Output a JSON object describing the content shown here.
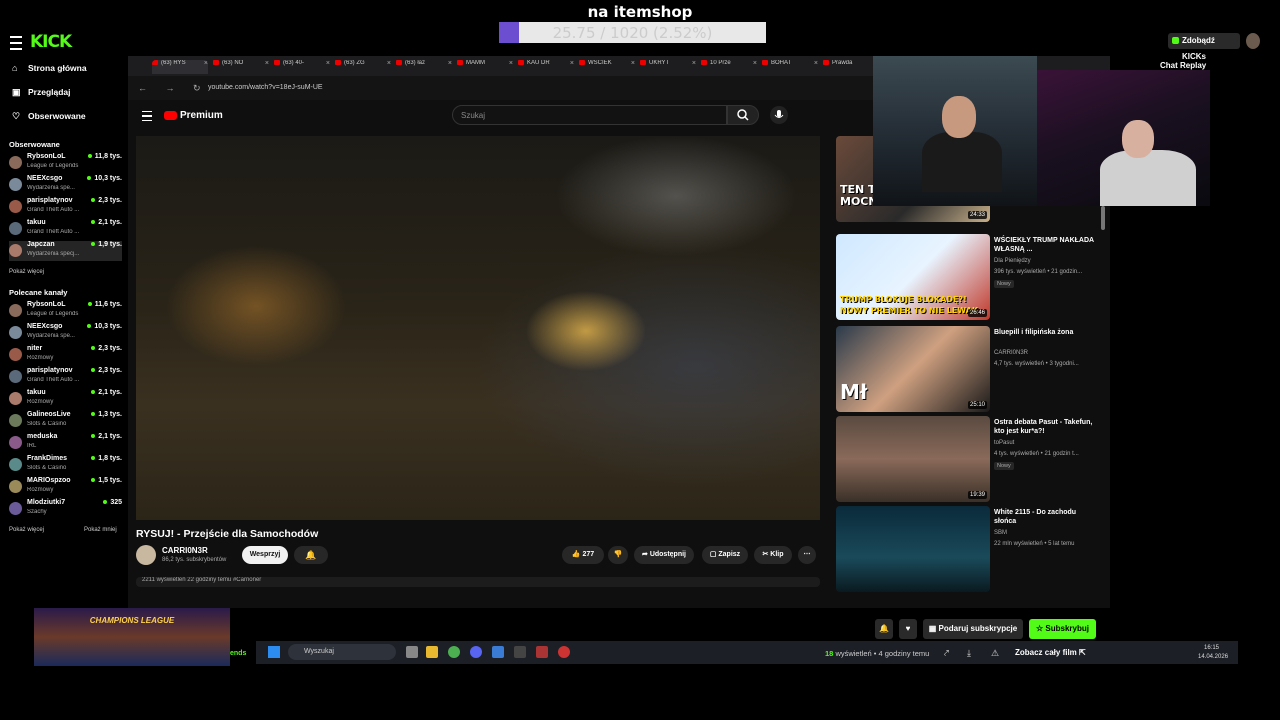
{
  "overlay": {
    "title": "na itemshop",
    "goal_text": "25.75 / 1020 (2.52%)",
    "goal_fraction": 0.0252
  },
  "kick": {
    "logo": "KICK",
    "kicks_button": "Zdobądź KICKs",
    "nav": [
      {
        "label": "Strona główna",
        "icon": "⌂"
      },
      {
        "label": "Przeglądaj",
        "icon": "▣"
      },
      {
        "label": "Obserwowane",
        "icon": "♡"
      }
    ],
    "followed_title": "Obserwowane",
    "followed": [
      {
        "name": "RybsonLoL",
        "game": "League of Legends",
        "viewers": "11,8 tys."
      },
      {
        "name": "NEEXcsgo",
        "game": "Wydarzenia spe...",
        "viewers": "10,3 tys."
      },
      {
        "name": "parisplatynov",
        "game": "Grand Theft Auto ...",
        "viewers": "2,3 tys."
      },
      {
        "name": "takuu",
        "game": "Grand Theft Auto ...",
        "viewers": "2,1 tys."
      },
      {
        "name": "Japczan",
        "game": "Wydarzenia specj...",
        "viewers": "1,9 tys."
      }
    ],
    "show_more": "Pokaż więcej",
    "recommended_title": "Polecane kanały",
    "recommended": [
      {
        "name": "RybsonLoL",
        "game": "League of Legends",
        "viewers": "11,6 tys."
      },
      {
        "name": "NEEXcsgo",
        "game": "Wydarzenia spe...",
        "viewers": "10,3 tys."
      },
      {
        "name": "niter",
        "game": "Rozmowy",
        "viewers": "2,3 tys."
      },
      {
        "name": "parisplatynov",
        "game": "Grand Theft Auto ...",
        "viewers": "2,3 tys."
      },
      {
        "name": "takuu",
        "game": "Rozmowy",
        "viewers": "2,1 tys."
      },
      {
        "name": "GalineosLive",
        "game": "Slots & Casino",
        "viewers": "1,3 tys."
      },
      {
        "name": "meduska",
        "game": "IRL",
        "viewers": "2,1 tys."
      },
      {
        "name": "FrankDimes",
        "game": "Slots & Casino",
        "viewers": "1,8 tys."
      },
      {
        "name": "MARIOspzoo",
        "game": "Rozmowy",
        "viewers": "1,5 tys."
      },
      {
        "name": "Mlodziutki7",
        "game": "Szachy",
        "viewers": "325"
      }
    ],
    "show_more_2": "Pokaż więcej",
    "show_less": "Pokaż mniej",
    "chat_replay": "Chat Replay",
    "bottom": {
      "promo_text": "CHAMPIONS LEAGUE",
      "friends": "ends",
      "gift_sub": "Podaruj subskrypcje",
      "subscribe": "Subskrybuj",
      "views_count": "18",
      "views_rest": "wyświetleń • 4 godziny temu",
      "full_film": "Zobacz cały film"
    }
  },
  "browser": {
    "tabs": [
      "(63) RYS",
      "(63) NO",
      "(63) 40-",
      "(63) ZG",
      "(63) łaz",
      "MAMM",
      "KAU DR",
      "WŚCIEK",
      "UKRYT",
      "10 Prze",
      "BOHAT",
      "Prawda"
    ],
    "url": "youtube.com/watch?v=18eJ-suM-UE",
    "yt_logo": "Premium",
    "search_placeholder": "Szukaj",
    "video_title": "RYSUJ! - Przejście dla Samochodów",
    "channel_name": "CARRI0N3R",
    "channel_subs": "86,2 tys. subskrybentów",
    "support_label": "Wesprzyj",
    "likes": "277",
    "share": "Udostępnij",
    "save": "Zapisz",
    "clip": "Klip",
    "desc_peek": "2211 wyświetleń  22 godziny temu  #Carrioner",
    "recs": [
      {
        "title": "",
        "channel": "",
        "meta": "",
        "badge": "Nowy",
        "duration": "24:33",
        "thumb_text": "TEN TELEFON BYŁ ZA MOCNY"
      },
      {
        "title": "WŚCIEKŁY TRUMP NAKŁADA WŁASNĄ ...",
        "channel": "Dla Pieniędzy",
        "meta": "396 tys. wyświetleń • 21 godzin...",
        "badge": "Nowy",
        "duration": "26:46",
        "thumb_text": "TRUMP BLOKUJE BLOKADĘ?! NOWY PREMIER TO NIE LEWAK"
      },
      {
        "title": "Bluepill i filipińska żona",
        "channel": "CARRI0N3R",
        "meta": "4,7 tys. wyświetleń • 3 tygodni...",
        "badge": "",
        "duration": "25:10",
        "thumb_text": "Mł"
      },
      {
        "title": "Ostra debata Pasut - Takefun, kto jest kur*a?!",
        "channel": "toPasut",
        "meta": "4 tys. wyświetleń • 21 godzin t...",
        "badge": "Nowy",
        "duration": "19:39",
        "thumb_text": ""
      },
      {
        "title": "White 2115 - Do zachodu słońca",
        "channel": "SBM",
        "meta": "22 mln wyświetleń • 5 lat temu",
        "badge": "",
        "duration": "",
        "thumb_text": ""
      }
    ],
    "taskbar_search": "Wyszukaj",
    "clock_time": "16:15",
    "clock_date": "14.04.2026"
  },
  "colors": {
    "kick_green": "#53fc18",
    "goal_fill": "#6b4fd0",
    "yt_red": "#ff0000"
  }
}
